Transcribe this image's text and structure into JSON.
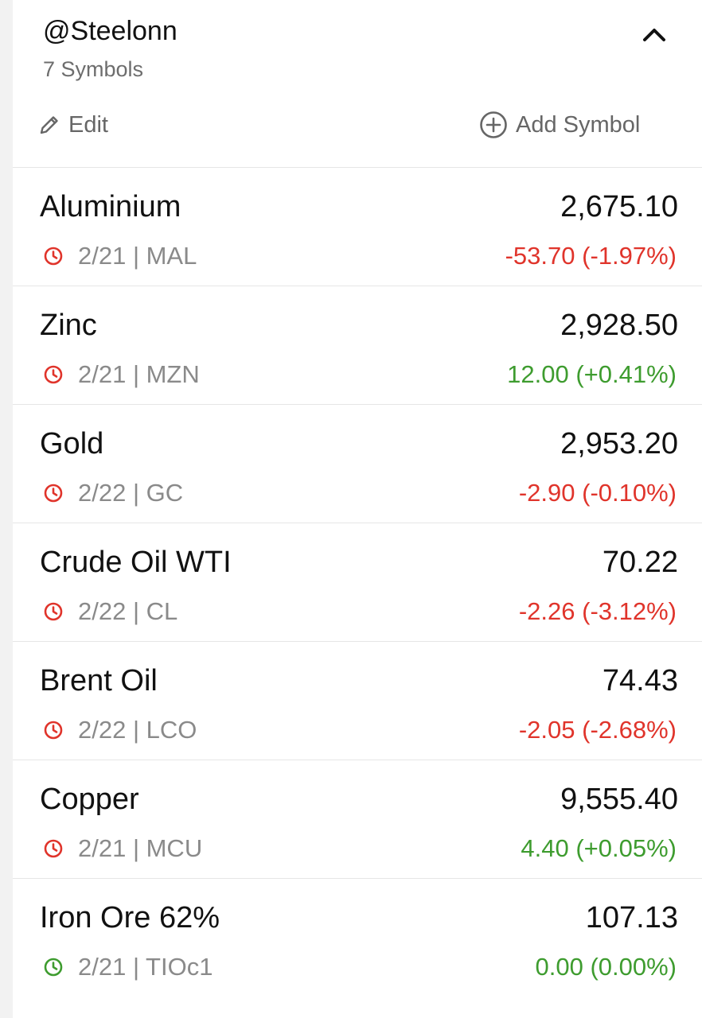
{
  "header": {
    "title": "@Steelonn",
    "subtitle": "7 Symbols",
    "edit_label": "Edit",
    "add_label": "Add Symbol"
  },
  "colors": {
    "negative": "#e0342b",
    "positive": "#3e9c2f",
    "market_closed_icon": "#e0342b",
    "market_open_icon": "#3e9c2f"
  },
  "icons": {
    "collapse": "chevron-up-icon",
    "edit": "pencil-icon",
    "add": "plus-circle-icon",
    "status": "clock-icon"
  },
  "symbols": [
    {
      "name": "Aluminium",
      "price": "2,675.10",
      "meta": "2/21 | MAL",
      "change": "-53.70 (-1.97%)",
      "direction": "down",
      "status": "closed"
    },
    {
      "name": "Zinc",
      "price": "2,928.50",
      "meta": "2/21 | MZN",
      "change": "12.00 (+0.41%)",
      "direction": "up",
      "status": "closed"
    },
    {
      "name": "Gold",
      "price": "2,953.20",
      "meta": "2/22 | GC",
      "change": "-2.90 (-0.10%)",
      "direction": "down",
      "status": "closed"
    },
    {
      "name": "Crude Oil WTI",
      "price": "70.22",
      "meta": "2/22 | CL",
      "change": "-2.26 (-3.12%)",
      "direction": "down",
      "status": "closed"
    },
    {
      "name": "Brent Oil",
      "price": "74.43",
      "meta": "2/22 | LCO",
      "change": "-2.05 (-2.68%)",
      "direction": "down",
      "status": "closed"
    },
    {
      "name": "Copper",
      "price": "9,555.40",
      "meta": "2/21 | MCU",
      "change": "4.40 (+0.05%)",
      "direction": "up",
      "status": "closed"
    },
    {
      "name": "Iron Ore 62%",
      "price": "107.13",
      "meta": "2/21 | TIOc1",
      "change": "0.00 (0.00%)",
      "direction": "up",
      "status": "open"
    }
  ]
}
